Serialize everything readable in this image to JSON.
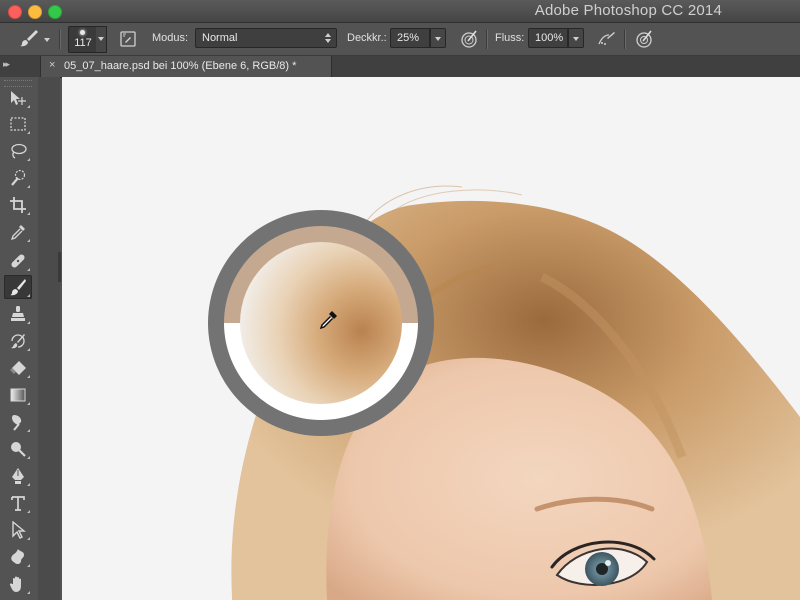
{
  "window": {
    "app_title": "Adobe Photoshop CC 2014"
  },
  "options_bar": {
    "brush_size": "117",
    "mode_label": "Modus:",
    "mode_value": "Normal",
    "opacity_label": "Deckkr.:",
    "opacity_value": "25%",
    "flow_label": "Fluss:",
    "flow_value": "100%"
  },
  "document": {
    "tab_close_glyph": "×",
    "tab_label": "05_07_haare.psd bei 100% (Ebene 6, RGB/8) *"
  },
  "toolbox": {
    "collapse_glyph": "▸▸",
    "tools": [
      {
        "name": "move-tool",
        "icon": "move-icon"
      },
      {
        "name": "marquee-tool",
        "icon": "marquee-icon"
      },
      {
        "name": "lasso-tool",
        "icon": "lasso-icon"
      },
      {
        "name": "quick-selection-tool",
        "icon": "quick-selection-icon"
      },
      {
        "name": "crop-tool",
        "icon": "crop-icon"
      },
      {
        "name": "eyedropper-tool",
        "icon": "eyedropper-icon"
      },
      {
        "name": "healing-brush-tool",
        "icon": "bandage-icon"
      },
      {
        "name": "brush-tool",
        "icon": "brush-icon",
        "active": true
      },
      {
        "name": "clone-stamp-tool",
        "icon": "stamp-icon"
      },
      {
        "name": "history-brush-tool",
        "icon": "history-brush-icon"
      },
      {
        "name": "eraser-tool",
        "icon": "eraser-icon"
      },
      {
        "name": "gradient-tool",
        "icon": "gradient-icon"
      },
      {
        "name": "smudge-tool",
        "icon": "smudge-icon"
      },
      {
        "name": "dodge-tool",
        "icon": "dodge-icon"
      },
      {
        "name": "pen-tool",
        "icon": "pen-icon"
      },
      {
        "name": "type-tool",
        "icon": "type-icon",
        "glyph": "T"
      },
      {
        "name": "path-selection-tool",
        "icon": "arrow-icon"
      },
      {
        "name": "custom-shape-tool",
        "icon": "shape-icon"
      },
      {
        "name": "hand-tool",
        "icon": "hand-icon"
      }
    ]
  },
  "color_ring": {
    "new_color": "#c4a890",
    "previous_color": "#ffffff",
    "ring_color": "#737373"
  },
  "colors": {
    "canvas_background": "#f4f4f4",
    "hair_light": "#e3c39c",
    "hair_mid": "#c99b68",
    "hair_dark": "#9a6a3e",
    "skin": "#edc7ab",
    "eye": "#6e8e9c"
  }
}
